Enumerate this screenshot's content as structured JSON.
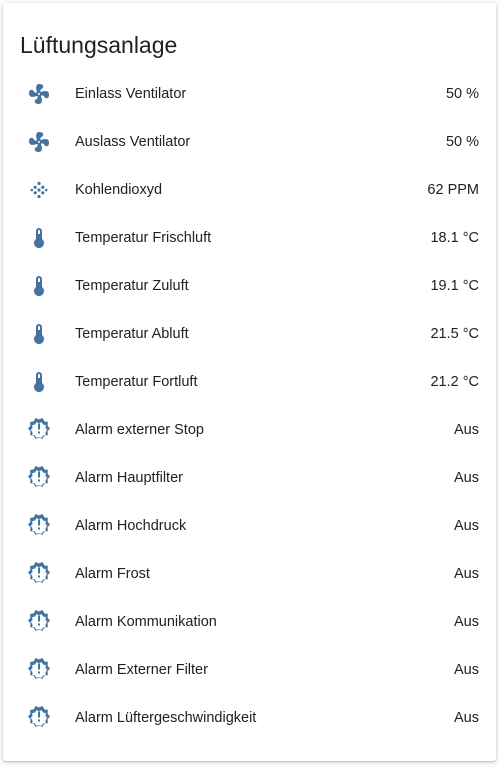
{
  "card": {
    "title": "Lüftungsanlage"
  },
  "colors": {
    "icon": "#44739e",
    "text": "#212121",
    "background": "#fafafa",
    "card": "#ffffff"
  },
  "entities": [
    {
      "icon": "fan-icon",
      "label": "Einlass Ventilator",
      "value": "50 %"
    },
    {
      "icon": "fan-icon",
      "label": "Auslass Ventilator",
      "value": "50 %"
    },
    {
      "icon": "molecule-co2-dots-icon",
      "label": "Kohlendioxyd",
      "value": "62 PPM"
    },
    {
      "icon": "thermometer-icon",
      "label": "Temperatur Frischluft",
      "value": "18.1 °C"
    },
    {
      "icon": "thermometer-icon",
      "label": "Temperatur Zuluft",
      "value": "19.1 °C"
    },
    {
      "icon": "thermometer-icon",
      "label": "Temperatur Abluft",
      "value": "21.5 °C"
    },
    {
      "icon": "thermometer-icon",
      "label": "Temperatur Fortluft",
      "value": "21.2 °C"
    },
    {
      "icon": "alert-decagram-outline-icon",
      "label": "Alarm externer Stop",
      "value": "Aus"
    },
    {
      "icon": "alert-decagram-outline-icon",
      "label": "Alarm Hauptfilter",
      "value": "Aus"
    },
    {
      "icon": "alert-decagram-outline-icon",
      "label": "Alarm Hochdruck",
      "value": "Aus"
    },
    {
      "icon": "alert-decagram-outline-icon",
      "label": "Alarm Frost",
      "value": "Aus"
    },
    {
      "icon": "alert-decagram-outline-icon",
      "label": "Alarm Kommunikation",
      "value": "Aus"
    },
    {
      "icon": "alert-decagram-outline-icon",
      "label": "Alarm Externer Filter",
      "value": "Aus"
    },
    {
      "icon": "alert-decagram-outline-icon",
      "label": "Alarm Lüftergeschwindigkeit",
      "value": "Aus"
    }
  ]
}
